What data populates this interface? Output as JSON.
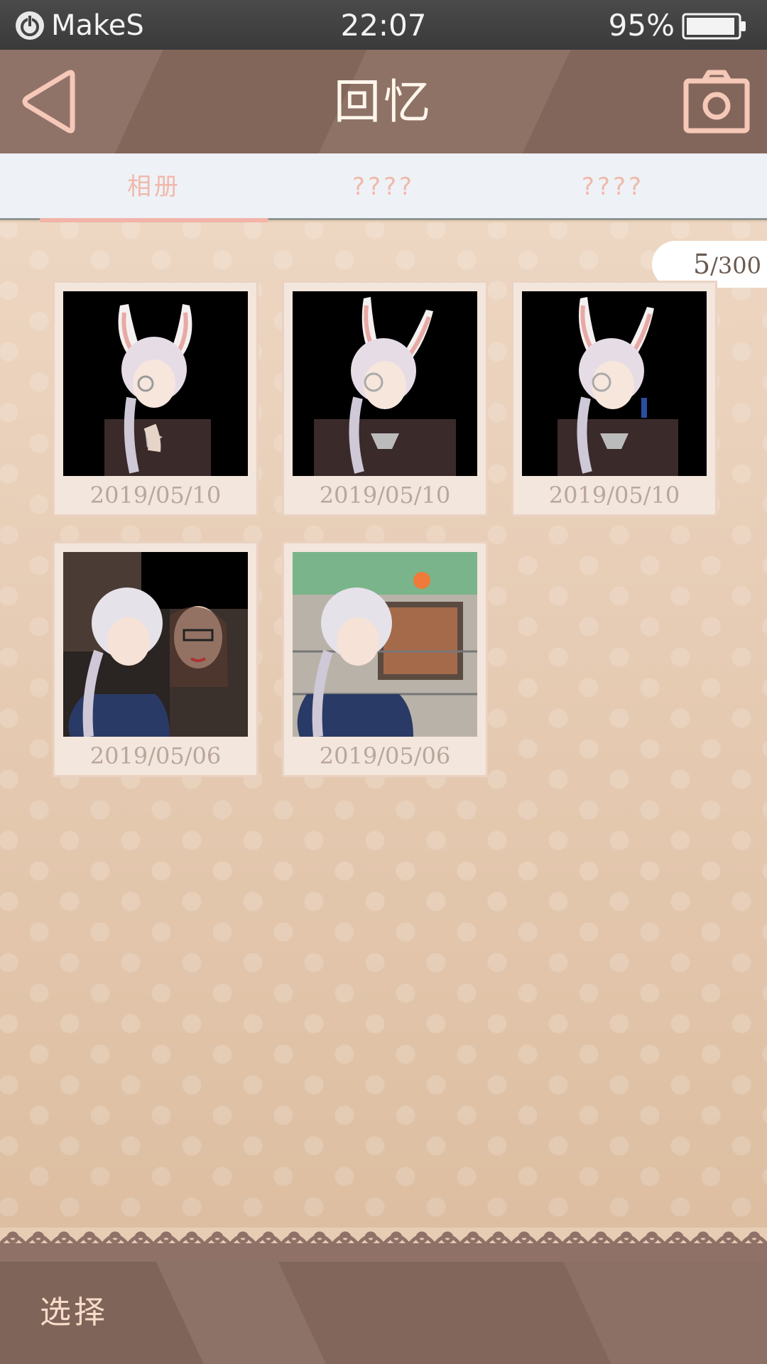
{
  "status_bar": {
    "brand": "MakeS",
    "time": "22:07",
    "battery": "95%",
    "battery_level": 0.95
  },
  "header": {
    "title": "回忆",
    "back_icon": "back-triangle-icon",
    "camera_icon": "camera-icon"
  },
  "tabs": [
    {
      "label": "相册",
      "active": true
    },
    {
      "label": "????",
      "active": false
    },
    {
      "label": "????",
      "active": false
    }
  ],
  "album": {
    "count_current": "5",
    "count_sep": "/",
    "count_max": "300",
    "photos": [
      {
        "date": "2019/05/10",
        "subject": "bunny-ear character"
      },
      {
        "date": "2019/05/10",
        "subject": "bunny-ear character"
      },
      {
        "date": "2019/05/10",
        "subject": "bunny-ear character"
      },
      {
        "date": "2019/05/06",
        "subject": "character with person"
      },
      {
        "date": "2019/05/06",
        "subject": "character in scene"
      }
    ]
  },
  "bottom_bar": {
    "select_label": "选择"
  },
  "colors": {
    "header": "#8a6c60",
    "tab_accent": "#f2b4a9",
    "content_bg": "#e4c8ad",
    "bottom_bar": "#876a5f"
  }
}
